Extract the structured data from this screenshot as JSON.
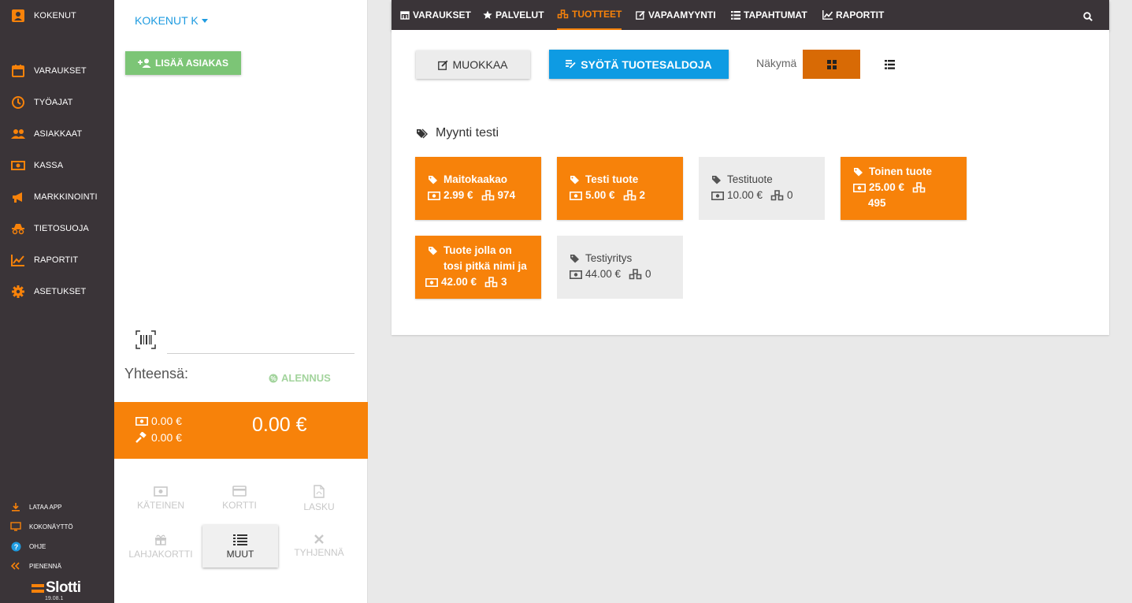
{
  "sidebar": {
    "header": "KOKENUT",
    "items": [
      {
        "label": "VARAUKSET"
      },
      {
        "label": "TYÖAJAT"
      },
      {
        "label": "ASIAKKAAT"
      },
      {
        "label": "KASSA"
      },
      {
        "label": "MARKKINOINTI"
      },
      {
        "label": "TIETOSUOJA"
      },
      {
        "label": "RAPORTIT"
      },
      {
        "label": "ASETUKSET"
      }
    ],
    "bottom_items": [
      {
        "label": "LATAA APP"
      },
      {
        "label": "KOKONÄYTTÖ"
      },
      {
        "label": "OHJE"
      },
      {
        "label": "PIENENNÄ"
      }
    ],
    "logo_text": "Slotti",
    "version": "19.08.1"
  },
  "cart": {
    "customer_dropdown": "KOKENUT K",
    "add_customer_label": "LISÄÄ ASIAKAS",
    "barcode_value": "",
    "total_label": "Yhteensä:",
    "discount_label": "ALENNUS",
    "cash_subtotal": "0.00 €",
    "tip_subtotal": "0.00 €",
    "total_amount": "0.00 €",
    "payment_buttons": [
      {
        "label": "KÄTEINEN",
        "icon": "cash-icon",
        "enabled": false
      },
      {
        "label": "KORTTI",
        "icon": "card-icon",
        "enabled": false
      },
      {
        "label": "LASKU",
        "icon": "invoice-icon",
        "enabled": false
      },
      {
        "label": "LAHJAKORTTI",
        "icon": "gift-icon",
        "enabled": false
      },
      {
        "label": "MUUT",
        "icon": "list-icon",
        "enabled": true
      },
      {
        "label": "TYHJENNÄ",
        "icon": "close-icon",
        "enabled": false
      }
    ]
  },
  "topnav": {
    "tabs": [
      {
        "label": "VARAUKSET",
        "icon": "calendar-icon"
      },
      {
        "label": "PALVELUT",
        "icon": "star-icon"
      },
      {
        "label": "TUOTTEET",
        "icon": "cubes-icon",
        "active": true
      },
      {
        "label": "VAPAAMYYNTI",
        "icon": "edit-icon"
      },
      {
        "label": "TAPAHTUMAT",
        "icon": "list-icon"
      },
      {
        "label": "RAPORTIT",
        "icon": "chart-icon"
      }
    ]
  },
  "products": {
    "edit_label": "MUOKKAA",
    "stock_entry_label": "SYÖTÄ TUOTESALDOJA",
    "view_label": "Näkymä",
    "view_mode": "grid",
    "group_title": "Myynti testi",
    "items": [
      {
        "name": "Maitokaakao",
        "price": "2.99 €",
        "stock": "974",
        "color": "orange"
      },
      {
        "name": "Testi tuote",
        "price": "5.00 €",
        "stock": "2",
        "color": "orange"
      },
      {
        "name": "Testituote",
        "price": "10.00 €",
        "stock": "0",
        "color": "grey"
      },
      {
        "name": "Toinen tuote",
        "price": "25.00 €",
        "stock": "495",
        "color": "orange"
      },
      {
        "name": "Tuote jolla on tosi pitkä nimi ja",
        "price": "42.00 €",
        "stock": "3",
        "color": "orange"
      },
      {
        "name": "Testiyritys",
        "price": "44.00 €",
        "stock": "0",
        "color": "grey"
      }
    ]
  },
  "colors": {
    "accent": "#f7820a",
    "sidebar_bg": "#3a3438",
    "primary_blue": "#0e9be3",
    "green": "#7cc576",
    "tile_grey": "#ececec"
  }
}
